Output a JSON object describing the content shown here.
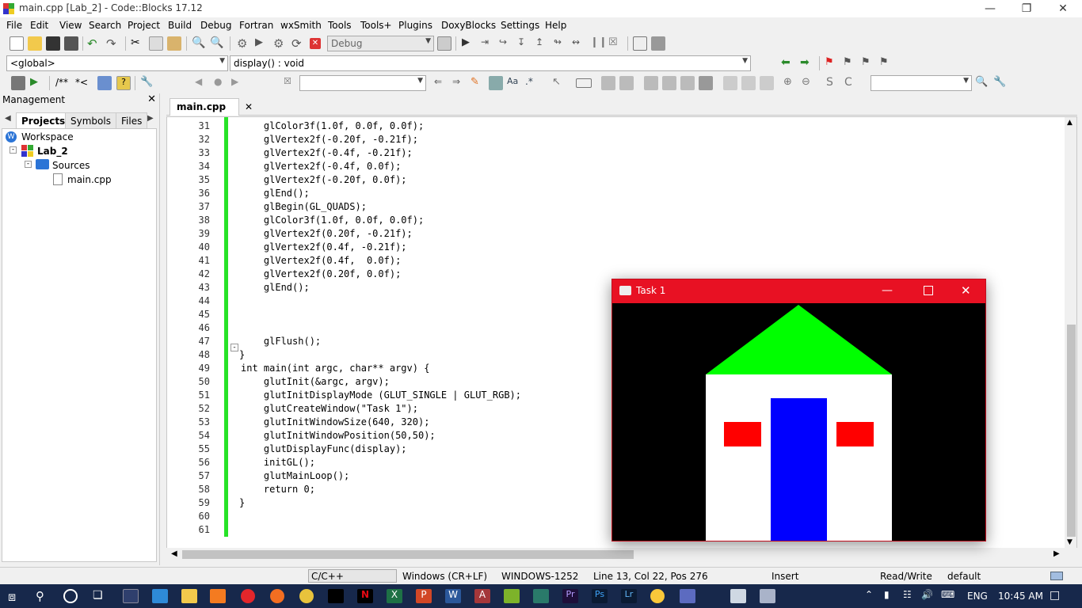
{
  "window": {
    "title": "main.cpp [Lab_2] - Code::Blocks 17.12"
  },
  "menu": [
    "File",
    "Edit",
    "View",
    "Search",
    "Project",
    "Build",
    "Debug",
    "Fortran",
    "wxSmith",
    "Tools",
    "Tools+",
    "Plugins",
    "DoxyBlocks",
    "Settings",
    "Help"
  ],
  "toolbar": {
    "build_target": "Debug",
    "scope": "<global>",
    "function": "display() : void",
    "doxy_comment": "/**",
    "doxy_line": "*<"
  },
  "management": {
    "title": "Management",
    "tabs": [
      "Projects",
      "Symbols",
      "Files"
    ],
    "tree": {
      "workspace": "Workspace",
      "project": "Lab_2",
      "folder": "Sources",
      "file": "main.cpp"
    }
  },
  "editor": {
    "tab": "main.cpp",
    "line_numbers": [
      "31",
      "32",
      "33",
      "34",
      "35",
      "36",
      "37",
      "38",
      "39",
      "40",
      "41",
      "42",
      "43",
      "44",
      "45",
      "46",
      "47",
      "48",
      "49",
      "50",
      "51",
      "52",
      "53",
      "54",
      "55",
      "56",
      "57",
      "58",
      "59",
      "60",
      "61"
    ],
    "lines": [
      {
        "text": "    glColor3f(1.0f, 0.0f, 0.0f);",
        "indent": true
      },
      {
        "text": "    glVertex2f(-0.20f, -0.21f);"
      },
      {
        "text": "    glVertex2f(-0.4f, -0.21f);"
      },
      {
        "text": "    glVertex2f(-0.4f, 0.0f);"
      },
      {
        "text": "    glVertex2f(-0.20f, 0.0f);"
      },
      {
        "text": "    glEnd();"
      },
      {
        "text": "    glBegin(GL_QUADS);"
      },
      {
        "text": "    glColor3f(1.0f, 0.0f, 0.0f);"
      },
      {
        "text": "    glVertex2f(0.20f, -0.21f);"
      },
      {
        "text": "    glVertex2f(0.4f, -0.21f);"
      },
      {
        "text": "    glVertex2f(0.4f,  0.0f);"
      },
      {
        "text": "    glVertex2f(0.20f, 0.0f);"
      },
      {
        "text": "    glEnd();"
      },
      {
        "text": ""
      },
      {
        "text": ""
      },
      {
        "text": ""
      },
      {
        "text": "    glFlush();"
      },
      {
        "text": "}"
      },
      {
        "text": "int main(int argc, char** argv) {"
      },
      {
        "text": "    glutInit(&argc, argv);"
      },
      {
        "text": "    glutInitDisplayMode (GLUT_SINGLE | GLUT_RGB);"
      },
      {
        "text": "    glutCreateWindow(\"Task 1\");"
      },
      {
        "text": "    glutInitWindowSize(640, 320);"
      },
      {
        "text": "    glutInitWindowPosition(50,50);"
      },
      {
        "text": "    glutDisplayFunc(display);"
      },
      {
        "text": "    initGL();"
      },
      {
        "text": "    glutMainLoop();"
      },
      {
        "text": "    return 0;"
      },
      {
        "text": "}"
      },
      {
        "text": ""
      },
      {
        "text": ""
      }
    ]
  },
  "status": {
    "language": "C/C++",
    "eol": "Windows (CR+LF)",
    "encoding": "WINDOWS-1252",
    "position": "Line 13, Col 22, Pos 276",
    "mode": "Insert",
    "access": "Read/Write",
    "profile": "default"
  },
  "taskbar": {
    "time": "10:45 AM",
    "lang": "ENG"
  },
  "gl_window": {
    "title": "Task 1",
    "colors": {
      "roof": "#00ff00",
      "wall": "#ffffff",
      "door": "#0000ff",
      "window": "#ff0000",
      "bg": "#000000"
    }
  }
}
